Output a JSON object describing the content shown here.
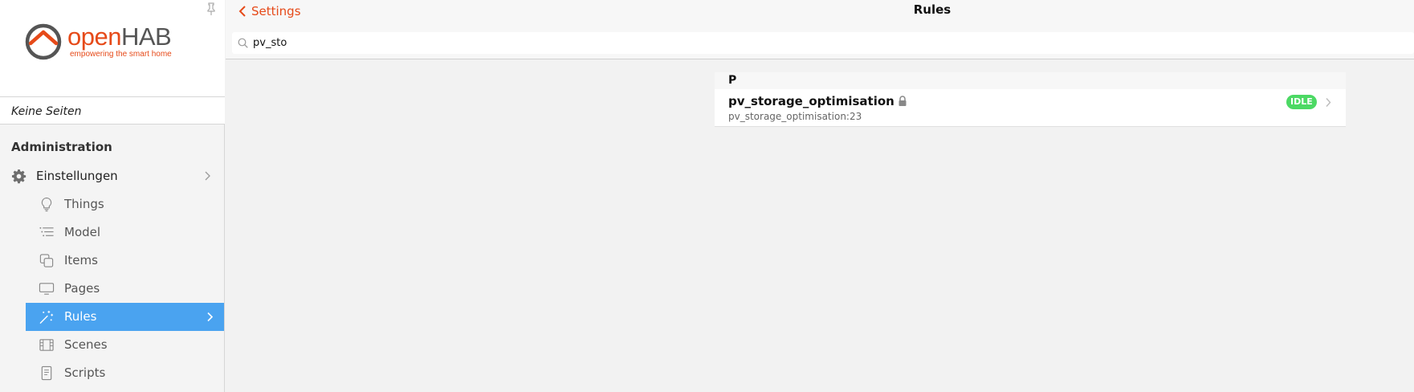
{
  "sidebar": {
    "logo": {
      "brand_open": "open",
      "brand_hab": "HAB",
      "tagline": "empowering the smart home"
    },
    "no_pages_label": "Keine Seiten",
    "admin_title": "Administration",
    "settings": {
      "label": "Einstellungen",
      "icon": "gear-icon"
    },
    "items": [
      {
        "label": "Things",
        "icon": "lightbulb-icon"
      },
      {
        "label": "Model",
        "icon": "list-tree-icon"
      },
      {
        "label": "Items",
        "icon": "items-squares-icon"
      },
      {
        "label": "Pages",
        "icon": "monitor-icon"
      },
      {
        "label": "Rules",
        "icon": "magic-wand-icon",
        "active": true
      },
      {
        "label": "Scenes",
        "icon": "film-icon"
      },
      {
        "label": "Scripts",
        "icon": "document-icon"
      }
    ],
    "accent_color": "#4aa3f0"
  },
  "header": {
    "back_label": "Settings",
    "title": "Rules",
    "brand_color": "#e64a19"
  },
  "search": {
    "value": "pv_sto"
  },
  "rules": {
    "groups": [
      {
        "letter": "P",
        "items": [
          {
            "name": "pv_storage_optimisation",
            "uid": "pv_storage_optimisation:23",
            "status": "IDLE",
            "locked": true
          }
        ]
      }
    ],
    "status_color": "#4cd964"
  }
}
